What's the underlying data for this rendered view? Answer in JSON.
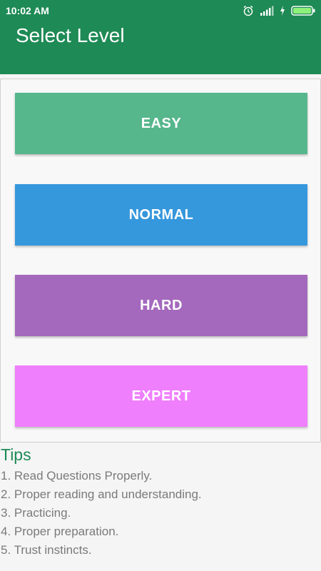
{
  "status_bar": {
    "time": "10:02 AM"
  },
  "header": {
    "title": "Select Level"
  },
  "levels": [
    {
      "label": "EASY",
      "color": "#56b68c"
    },
    {
      "label": "NORMAL",
      "color": "#3597dc"
    },
    {
      "label": "HARD",
      "color": "#a469bd"
    },
    {
      "label": "EXPERT",
      "color": "#ef7ffd"
    }
  ],
  "tips": {
    "title": "Tips",
    "items": [
      "1. Read Questions Properly.",
      "2. Proper reading and understanding.",
      "3. Practicing.",
      "4. Proper preparation.",
      "5. Trust instincts."
    ]
  },
  "icons": [
    "alarm-icon",
    "signal-icon",
    "charging-icon",
    "battery-icon"
  ]
}
